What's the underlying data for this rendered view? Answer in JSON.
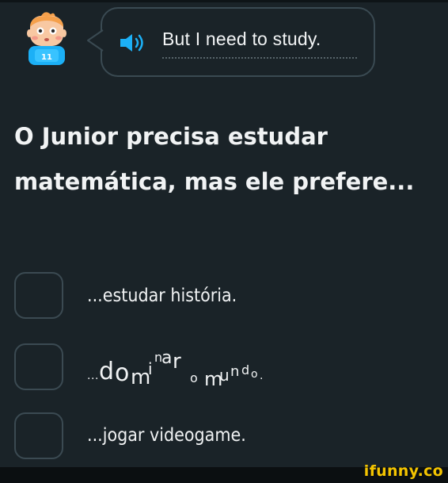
{
  "speech": {
    "text": "But I need to study."
  },
  "prompt": {
    "text": "O Junior precisa estudar matemática, mas ele prefere..."
  },
  "options": [
    {
      "label": "...estudar história."
    },
    {
      "label": "...dominar o mundo."
    },
    {
      "label": "...jogar videogame."
    }
  ],
  "watermark": {
    "text": "ifunny.co"
  },
  "colors": {
    "background": "#1a2328",
    "border": "#3b4a52",
    "speaker": "#1cb0f6",
    "watermark": "#f4c400"
  },
  "icons": {
    "avatar": "junior-character-avatar",
    "speaker": "speaker-audio-icon"
  }
}
